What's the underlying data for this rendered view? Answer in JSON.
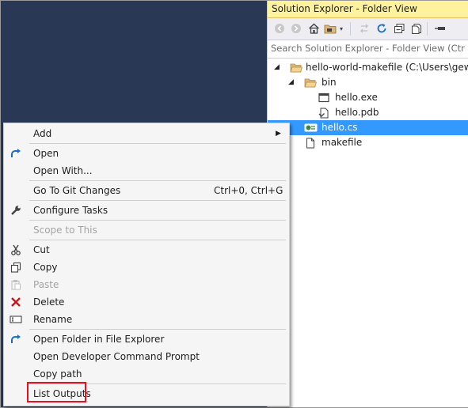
{
  "solution_explorer": {
    "title": "Solution Explorer - Folder View",
    "search_placeholder": "Search Solution Explorer - Folder View (Ctrl+;)",
    "toolbar_icons": [
      "back-icon",
      "forward-icon",
      "home-icon",
      "folder-switch-icon",
      "dropdown-icon",
      "sync-icon",
      "refresh-icon",
      "collapse-all-icon",
      "show-all-files-icon",
      "pin-icon"
    ],
    "tree": [
      {
        "label": "hello-world-makefile (C:\\Users\\gewarren\\...",
        "icon": "folder-open-icon",
        "depth": 0,
        "expanded": true
      },
      {
        "label": "bin",
        "icon": "folder-open-icon",
        "depth": 1,
        "expanded": true
      },
      {
        "label": "hello.exe",
        "icon": "exe-file-icon",
        "depth": 2
      },
      {
        "label": "hello.pdb",
        "icon": "pdb-file-icon",
        "depth": 2
      },
      {
        "label": "hello.cs",
        "icon": "csharp-file-icon",
        "depth": 1,
        "selected": true
      },
      {
        "label": "makefile",
        "icon": "file-icon",
        "depth": 1
      }
    ]
  },
  "context_menu": {
    "items": [
      {
        "label": "Add",
        "submenu": true
      },
      {
        "label": "Open",
        "icon": "open-arrow-icon"
      },
      {
        "label": "Open With..."
      },
      {
        "label": "Go To Git Changes",
        "shortcut": "Ctrl+0, Ctrl+G"
      },
      {
        "label": "Configure Tasks",
        "icon": "wrench-icon"
      },
      {
        "label": "Scope to This",
        "disabled": true
      },
      {
        "label": "Cut",
        "icon": "scissors-icon"
      },
      {
        "label": "Copy",
        "icon": "copy-icon"
      },
      {
        "label": "Paste",
        "icon": "paste-icon",
        "disabled": true
      },
      {
        "label": "Delete",
        "icon": "delete-x-icon"
      },
      {
        "label": "Rename",
        "icon": "rename-icon"
      },
      {
        "label": "Open Folder in File Explorer",
        "icon": "open-arrow-icon"
      },
      {
        "label": "Open Developer Command Prompt"
      },
      {
        "label": "Copy path"
      },
      {
        "label": "List Outputs",
        "highlighted": true
      }
    ]
  },
  "colors": {
    "editor_background": "#293955",
    "selection": "#3399ff",
    "title_bar": "#fff29d",
    "highlight_box": "#e81123",
    "delete_icon": "#c5161d"
  }
}
